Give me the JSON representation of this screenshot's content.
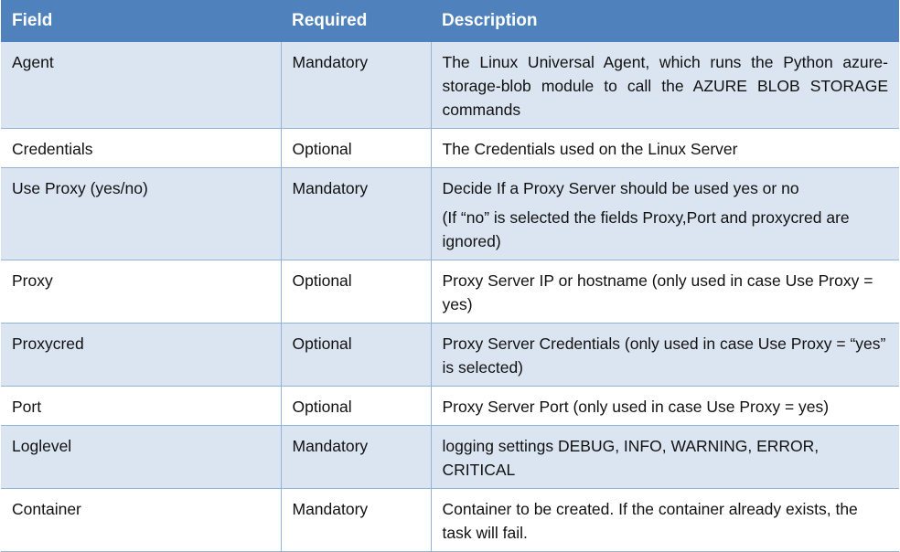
{
  "table": {
    "headers": {
      "field": "Field",
      "required": "Required",
      "description": "Description"
    },
    "rows": [
      {
        "field": "Agent",
        "required": "Mandatory",
        "description": "The Linux Universal Agent, which runs the Python azure-storage-blob module to call the AZURE BLOB STORAGE commands"
      },
      {
        "field": "Credentials",
        "required": "Optional",
        "description": "The Credentials used on the Linux Server"
      },
      {
        "field": "Use Proxy (yes/no)",
        "required": "Mandatory",
        "description": "Decide If a Proxy Server should be used yes or no",
        "description_note": "(If “no” is selected the fields Proxy,Port and proxycred are ignored)"
      },
      {
        "field": "Proxy",
        "required": "Optional",
        "description": "Proxy Server IP or hostname (only used in case Use Proxy = yes)"
      },
      {
        "field": "Proxycred",
        "required": "Optional",
        "description": "Proxy Server Credentials (only used in case Use Proxy = “yes” is selected)"
      },
      {
        "field": "Port",
        "required": "Optional",
        "description": "Proxy Server Port (only used in case Use Proxy = yes)"
      },
      {
        "field": "Loglevel",
        "required": "Mandatory",
        "description": "logging settings DEBUG, INFO, WARNING, ERROR, CRITICAL"
      },
      {
        "field": "Container",
        "required": "Mandatory",
        "description": "Container to be created. If the container already exists, the task will fail."
      }
    ]
  },
  "colors": {
    "header_bg": "#4f81bd",
    "header_text": "#ffffff",
    "row_shaded": "#dbe5f1",
    "row_plain": "#ffffff",
    "border": "#95b3d7"
  }
}
